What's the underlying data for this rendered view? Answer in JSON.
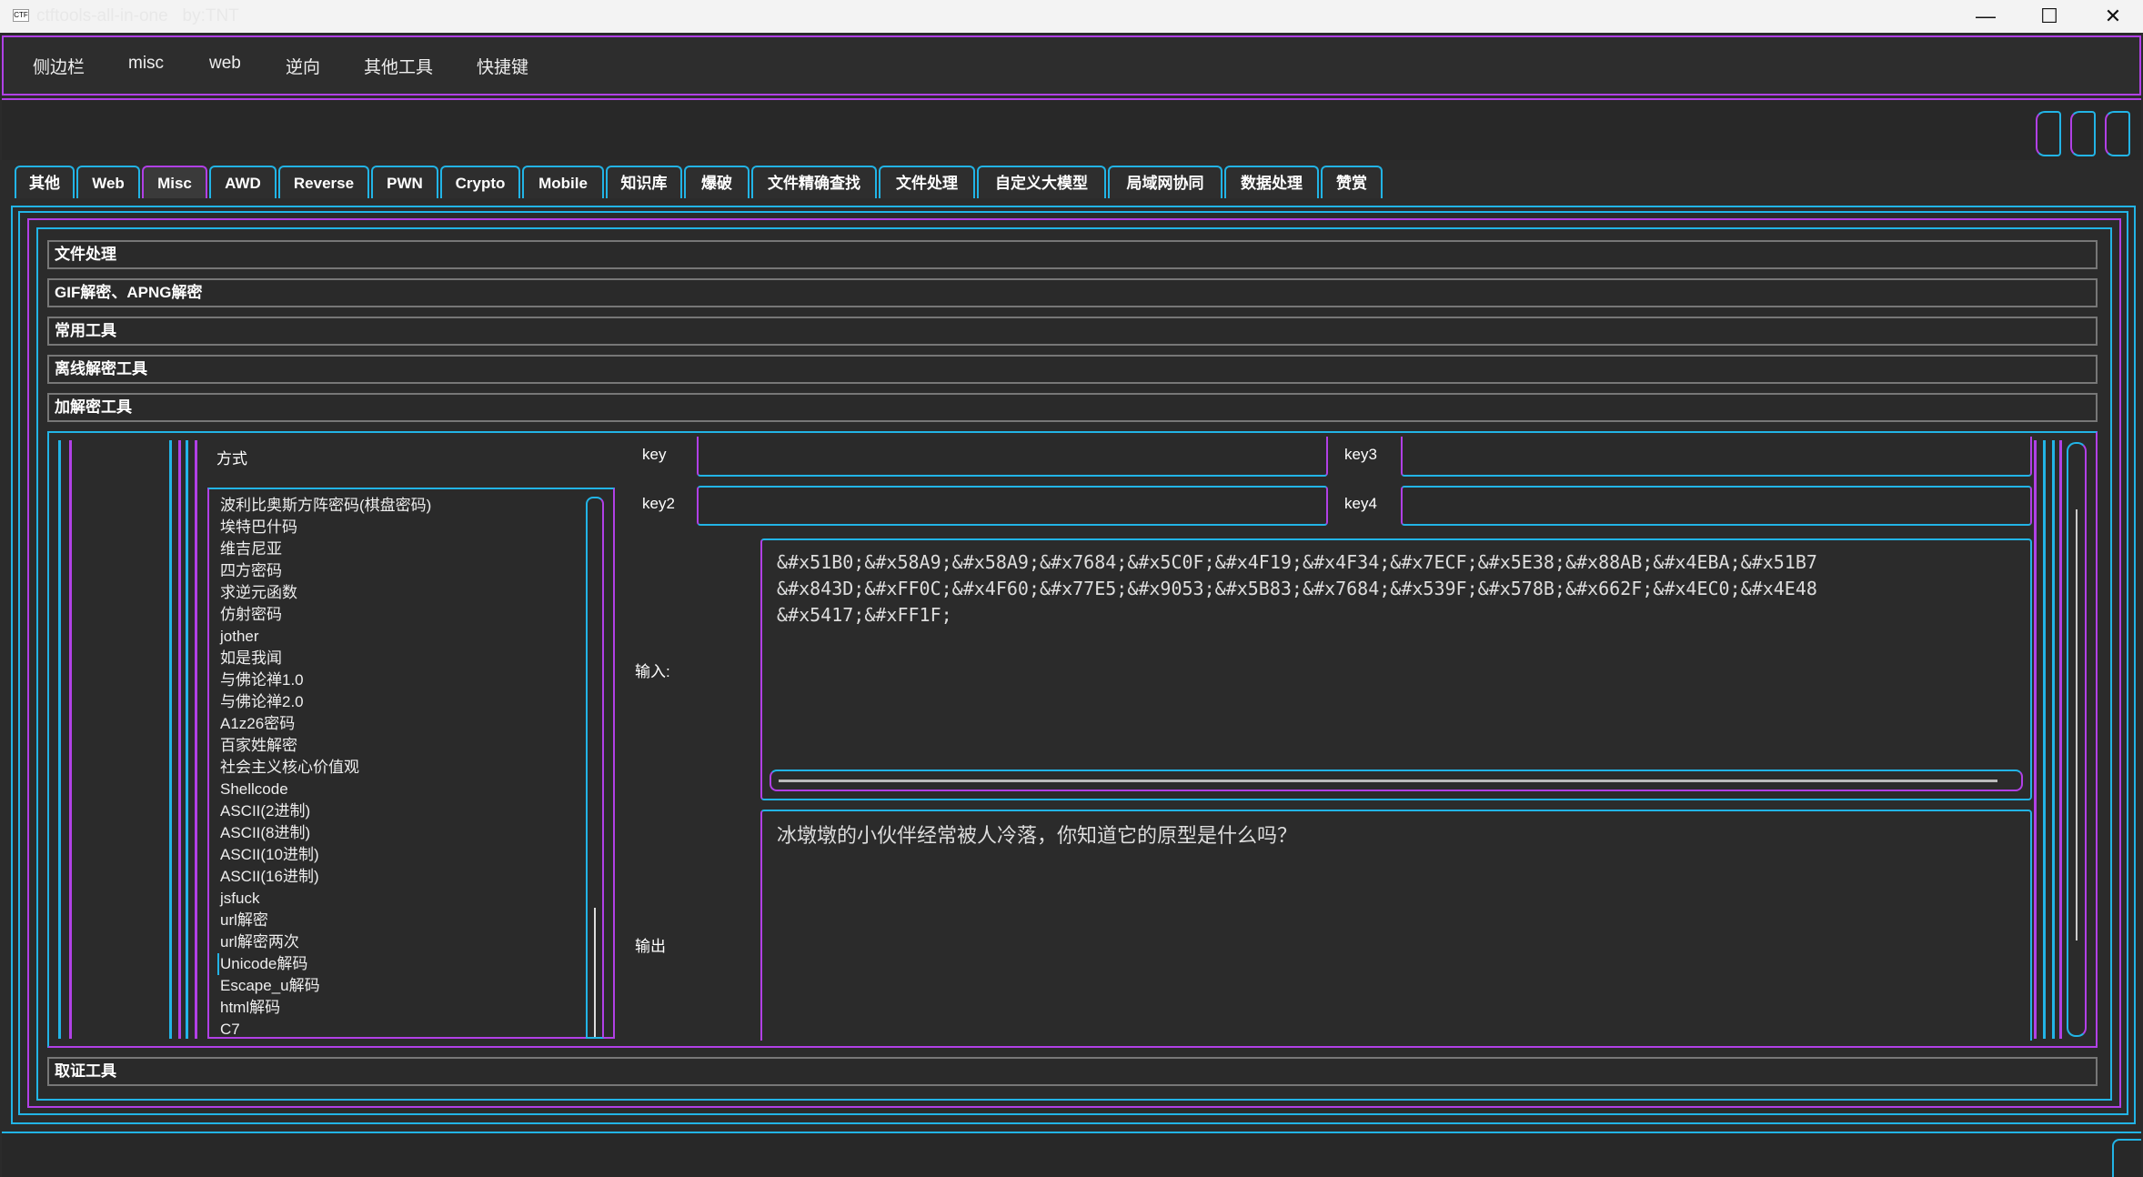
{
  "window": {
    "icon_text": "CTF",
    "title": "ctftools-all-in-one   by:TNT",
    "minimize_glyph": "—",
    "maximize_glyph": "☐",
    "close_glyph": "✕"
  },
  "menubar": [
    "侧边栏",
    "misc",
    "web",
    "逆向",
    "其他工具",
    "快捷键"
  ],
  "tabs": [
    "其他",
    "Web",
    "Misc",
    "AWD",
    "Reverse",
    "PWN",
    "Crypto",
    "Mobile",
    "知识库",
    "爆破",
    "文件精确查找",
    "文件处理",
    "自定义大模型",
    "局域网协同",
    "数据处理",
    "赞赏"
  ],
  "active_tab": "Misc",
  "groups": [
    "文件处理",
    "GIF解密、APNG解密",
    "常用工具",
    "离线解密工具",
    "加解密工具",
    "取证工具"
  ],
  "crypto": {
    "method_label": "方式",
    "methods": [
      "波利比奥斯方阵密码(棋盘密码)",
      "埃特巴什码",
      "维吉尼亚",
      "四方密码",
      "求逆元函数",
      "仿射密码",
      "jother",
      "如是我闻",
      "与佛论禅1.0",
      "与佛论禅2.0",
      "A1z26密码",
      "百家姓解密",
      "社会主义核心价值观",
      "Shellcode",
      "ASCII(2进制)",
      "ASCII(8进制)",
      "ASCII(10进制)",
      "ASCII(16进制)",
      "jsfuck",
      "url解密",
      "url解密两次",
      "Unicode解码",
      "Escape_u解码",
      "html解码",
      "C7"
    ],
    "key_label": "key",
    "key2_label": "key2",
    "key3_label": "key3",
    "key4_label": "key4",
    "input_label": "输入:",
    "output_label": "输出",
    "input_lines": [
      "&#x51B0;&#x58A9;&#x58A9;&#x7684;&#x5C0F;&#x4F19;&#x4F34;&#x7ECF;&#x5E38;&#x88AB;&#x4EBA;&#x51B7",
      "&#x843D;&#xFF0C;&#x4F60;&#x77E5;&#x9053;&#x5B83;&#x7684;&#x539F;&#x578B;&#x662F;&#x4EC0;&#x4E48",
      "&#x5417;&#xFF1F;"
    ],
    "output_text": "冰墩墩的小伙伴经常被人冷落，你知道它的原型是什么吗？"
  },
  "colors": {
    "accent_cyan": "#22b4e6",
    "accent_purple": "#b140e6",
    "background": "#2b2b2b"
  }
}
